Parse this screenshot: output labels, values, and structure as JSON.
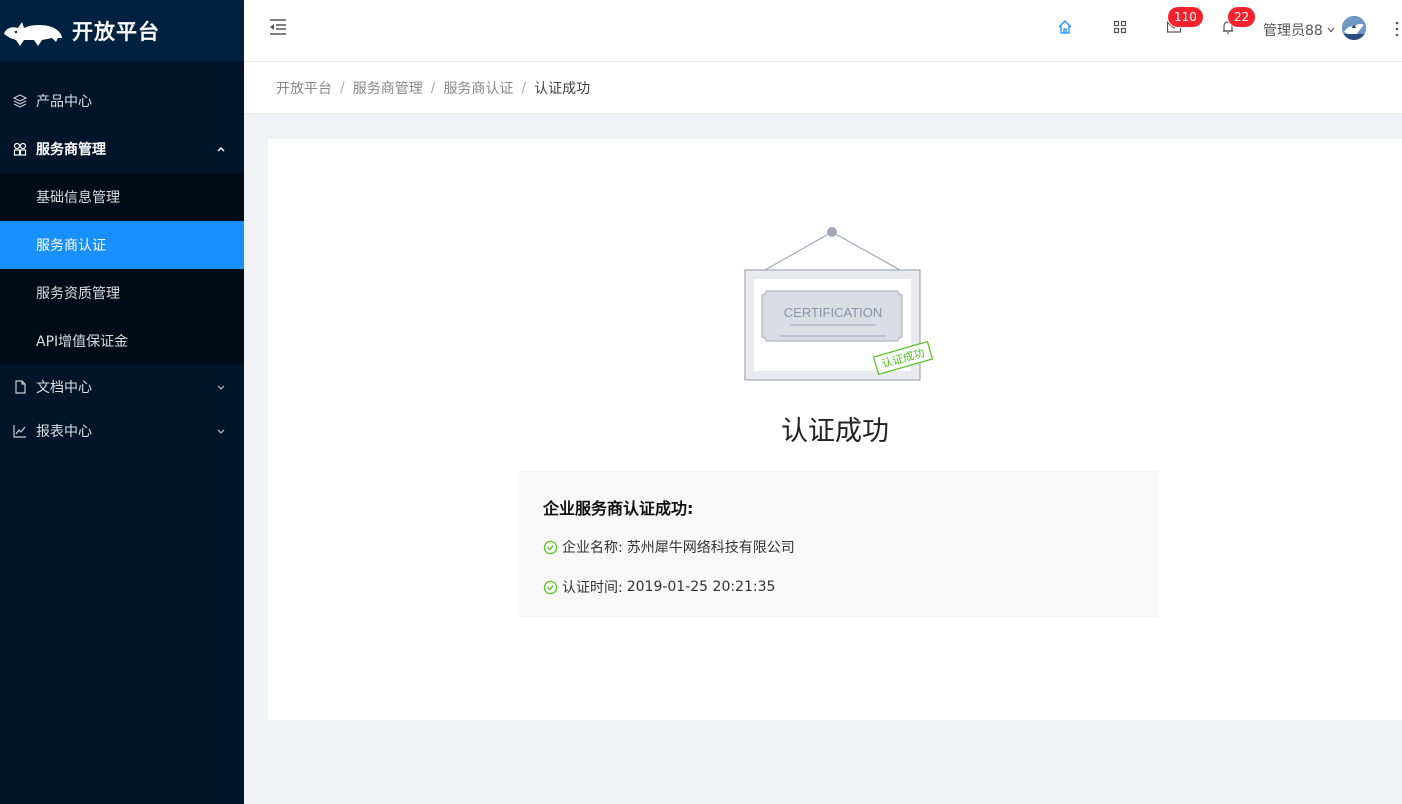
{
  "app": {
    "title": "开放平台"
  },
  "sidebar": {
    "items": [
      {
        "label": "产品中心",
        "icon": "layers-icon"
      },
      {
        "label": "服务商管理",
        "icon": "appstore-icon",
        "open": true,
        "children": [
          {
            "label": "基础信息管理"
          },
          {
            "label": "服务商认证",
            "active": true
          },
          {
            "label": "服务资质管理"
          },
          {
            "label": "API增值保证金"
          }
        ]
      },
      {
        "label": "文档中心",
        "icon": "file-icon"
      },
      {
        "label": "报表中心",
        "icon": "line-chart-icon"
      }
    ]
  },
  "header": {
    "mail_badge": "110",
    "notify_badge": "22",
    "user_name": "管理员88"
  },
  "breadcrumb": [
    "开放平台",
    "服务商管理",
    "服务商认证",
    "认证成功"
  ],
  "breadcrumb_sep": "/",
  "result": {
    "illustration_heading": "CERTIFICATION",
    "stamp_text": "认证成功",
    "title": "认证成功",
    "info_heading": "企业服务商认证成功:",
    "rows": [
      {
        "label": "企业名称:",
        "value": "苏州犀牛网络科技有限公司"
      },
      {
        "label": "认证时间:",
        "value": "2019-01-25 20:21:35"
      }
    ]
  },
  "colors": {
    "sidebar_bg": "#001529",
    "active": "#1890ff",
    "badge": "#f5222d",
    "success": "#52c41a"
  }
}
